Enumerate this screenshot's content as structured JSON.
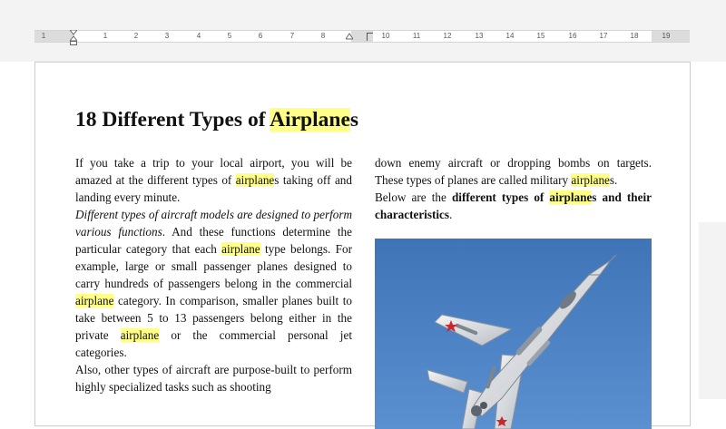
{
  "ruler": {
    "labels": [
      "1",
      "1",
      "2",
      "3",
      "4",
      "5",
      "6",
      "7",
      "8",
      "10",
      "11",
      "12",
      "13",
      "14",
      "15",
      "16",
      "17",
      "18",
      "19"
    ]
  },
  "document": {
    "title": {
      "prefix": "18 Different Types of ",
      "highlight": "Airplane",
      "suffix": "s"
    },
    "left_column": {
      "p1": {
        "a": "If you take a trip to your local airport, you will be amazed at the different types of ",
        "hl": "airplane",
        "b": "s taking off and landing every minute."
      },
      "p2": {
        "italic": "Different types of aircraft models are designed to perform various functions",
        "a": ". And these functions determine the particular category that each ",
        "hl1": "airplane",
        "b": " type belongs. For example, large or small passenger planes designed to carry hundreds of passengers belong in the commercial ",
        "hl2": "airplane",
        "c": " category. In comparison, smaller planes built to take between 5 to 13 passengers belong either in the private ",
        "hl3": "airplane",
        "d": " or the commercial personal jet categories."
      },
      "p3": {
        "a": "Also, other types of aircraft are purpose-built to perform highly specialized tasks such as shooting"
      }
    },
    "right_column": {
      "p1": {
        "a": "down enemy aircraft or dropping bombs on targets. These types of planes are called military ",
        "hl": "airplane",
        "b": "s."
      },
      "p2": {
        "a": "Below are the ",
        "bold1": "different types of ",
        "hl": "airplane",
        "bold2": "s and their characteristics",
        "b": "."
      },
      "image": {
        "subject": "military jet aircraft in flight against blue sky",
        "sky_color": "#4a80c2",
        "highlight_color": "#ffff88"
      }
    }
  }
}
